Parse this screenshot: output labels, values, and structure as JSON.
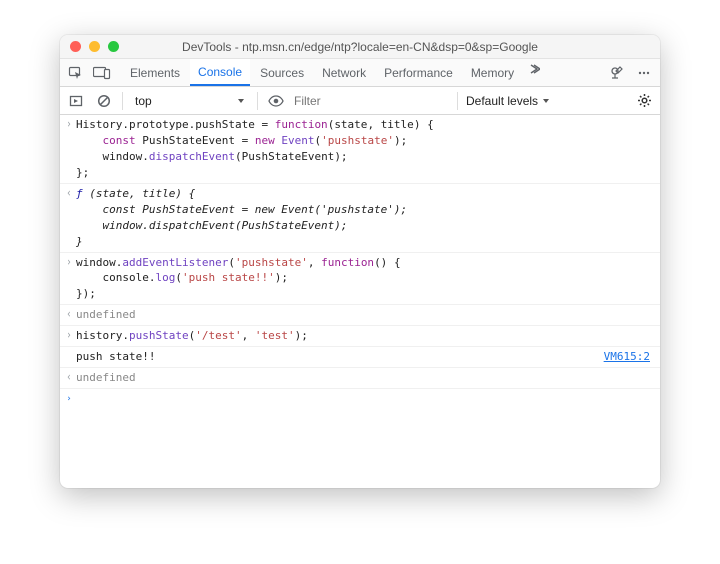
{
  "titlebar": {
    "title": "DevTools - ntp.msn.cn/edge/ntp?locale=en-CN&dsp=0&sp=Google"
  },
  "tabs": {
    "elements": "Elements",
    "console": "Console",
    "sources": "Sources",
    "network": "Network",
    "performance": "Performance",
    "memory": "Memory"
  },
  "toolbar": {
    "context": "top",
    "filter_placeholder": "Filter",
    "levels_label": "Default levels"
  },
  "console_rows": {
    "r0": "History.prototype.pushState = function(state, title) {\n    const PushStateEvent = new Event('pushstate');\n    window.dispatchEvent(PushStateEvent);\n};",
    "r1": "ƒ (state, title) {\n    const PushStateEvent = new Event('pushstate');\n    window.dispatchEvent(PushStateEvent);\n}",
    "r2": "window.addEventListener('pushstate', function() {\n    console.log('push state!!');\n});",
    "r3": "undefined",
    "r4": "history.pushState('/test', 'test');",
    "r5": "push state!!",
    "r5_loc": "VM615:2",
    "r6": "undefined"
  }
}
